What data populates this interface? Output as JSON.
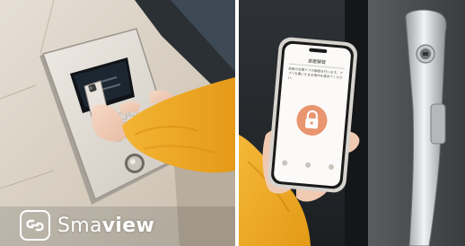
{
  "left_photo": {
    "subject": "hand holding smartphone against intercom panel",
    "sleeve_color": "#f2ad28",
    "wall_color": "#dcd3c6"
  },
  "right_photo": {
    "subject": "hand holding smartphone near door handle",
    "phone_screen": {
      "title": "部屋解錠",
      "body": "部屋の玄関ドアの解錠を行います。アプリを開いたまま操作を進めてください。",
      "unlock_button_color": "#e9956f"
    }
  },
  "logo": {
    "name_light": "Sma",
    "name_bold": "view",
    "icon": "link-icon"
  }
}
